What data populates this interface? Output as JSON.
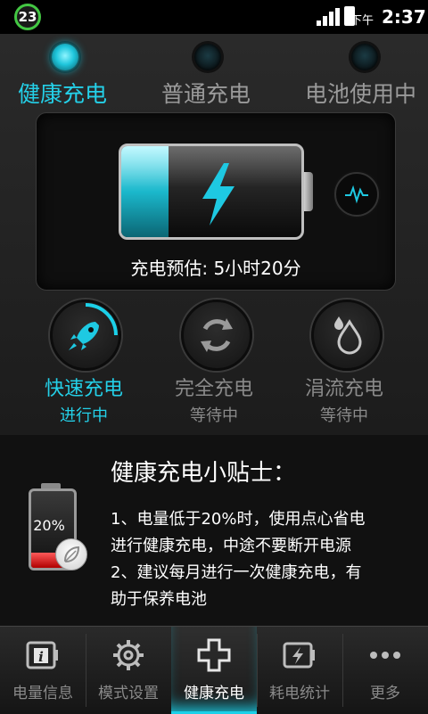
{
  "status_bar": {
    "notification_count": "23",
    "am_pm": "下午",
    "time": "2:37"
  },
  "top_tabs": [
    {
      "label": "健康充电",
      "active": true
    },
    {
      "label": "普通充电",
      "active": false
    },
    {
      "label": "电池使用中",
      "active": false
    }
  ],
  "panel": {
    "estimate": "充电预估: 5小时20分",
    "battery_charge_fraction": 0.26,
    "accent_color": "#24d0e8"
  },
  "modes": [
    {
      "label": "快速充电",
      "status": "进行中",
      "icon": "rocket-icon",
      "active": true
    },
    {
      "label": "完全充电",
      "status": "等待中",
      "icon": "refresh-icon",
      "active": false
    },
    {
      "label": "涓流充电",
      "status": "等待中",
      "icon": "water-drop-icon",
      "active": false
    }
  ],
  "tips": {
    "title": "健康充电小贴士：",
    "battery_level": "20%",
    "lines": [
      "1、电量低于20%时，使用点心省电",
      "进行健康充电，中途不要断开电源",
      "2、建议每月进行一次健康充电，有",
      "助于保养电池"
    ]
  },
  "bottom_nav": [
    {
      "label": "电量信息",
      "icon": "info-battery-icon",
      "active": false
    },
    {
      "label": "模式设置",
      "icon": "gear-icon",
      "active": false
    },
    {
      "label": "健康充电",
      "icon": "plus-icon",
      "active": true
    },
    {
      "label": "耗电统计",
      "icon": "battery-bolt-icon",
      "active": false
    },
    {
      "label": "更多",
      "icon": "more-dots-icon",
      "active": false
    }
  ]
}
